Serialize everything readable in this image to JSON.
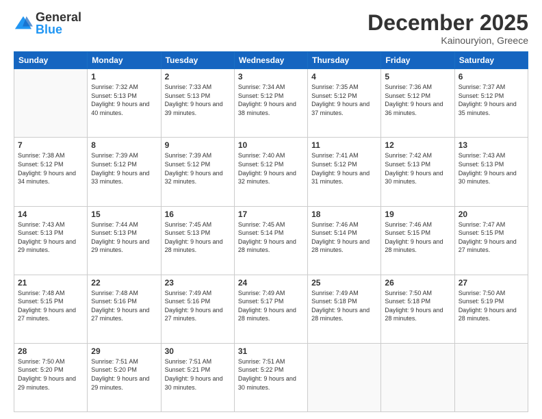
{
  "logo": {
    "general": "General",
    "blue": "Blue"
  },
  "header": {
    "month": "December 2025",
    "location": "Kainouryion, Greece"
  },
  "weekdays": [
    "Sunday",
    "Monday",
    "Tuesday",
    "Wednesday",
    "Thursday",
    "Friday",
    "Saturday"
  ],
  "weeks": [
    [
      {
        "day": "",
        "sunrise": "",
        "sunset": "",
        "daylight": ""
      },
      {
        "day": "1",
        "sunrise": "Sunrise: 7:32 AM",
        "sunset": "Sunset: 5:13 PM",
        "daylight": "Daylight: 9 hours and 40 minutes."
      },
      {
        "day": "2",
        "sunrise": "Sunrise: 7:33 AM",
        "sunset": "Sunset: 5:13 PM",
        "daylight": "Daylight: 9 hours and 39 minutes."
      },
      {
        "day": "3",
        "sunrise": "Sunrise: 7:34 AM",
        "sunset": "Sunset: 5:12 PM",
        "daylight": "Daylight: 9 hours and 38 minutes."
      },
      {
        "day": "4",
        "sunrise": "Sunrise: 7:35 AM",
        "sunset": "Sunset: 5:12 PM",
        "daylight": "Daylight: 9 hours and 37 minutes."
      },
      {
        "day": "5",
        "sunrise": "Sunrise: 7:36 AM",
        "sunset": "Sunset: 5:12 PM",
        "daylight": "Daylight: 9 hours and 36 minutes."
      },
      {
        "day": "6",
        "sunrise": "Sunrise: 7:37 AM",
        "sunset": "Sunset: 5:12 PM",
        "daylight": "Daylight: 9 hours and 35 minutes."
      }
    ],
    [
      {
        "day": "7",
        "sunrise": "Sunrise: 7:38 AM",
        "sunset": "Sunset: 5:12 PM",
        "daylight": "Daylight: 9 hours and 34 minutes."
      },
      {
        "day": "8",
        "sunrise": "Sunrise: 7:39 AM",
        "sunset": "Sunset: 5:12 PM",
        "daylight": "Daylight: 9 hours and 33 minutes."
      },
      {
        "day": "9",
        "sunrise": "Sunrise: 7:39 AM",
        "sunset": "Sunset: 5:12 PM",
        "daylight": "Daylight: 9 hours and 32 minutes."
      },
      {
        "day": "10",
        "sunrise": "Sunrise: 7:40 AM",
        "sunset": "Sunset: 5:12 PM",
        "daylight": "Daylight: 9 hours and 32 minutes."
      },
      {
        "day": "11",
        "sunrise": "Sunrise: 7:41 AM",
        "sunset": "Sunset: 5:12 PM",
        "daylight": "Daylight: 9 hours and 31 minutes."
      },
      {
        "day": "12",
        "sunrise": "Sunrise: 7:42 AM",
        "sunset": "Sunset: 5:13 PM",
        "daylight": "Daylight: 9 hours and 30 minutes."
      },
      {
        "day": "13",
        "sunrise": "Sunrise: 7:43 AM",
        "sunset": "Sunset: 5:13 PM",
        "daylight": "Daylight: 9 hours and 30 minutes."
      }
    ],
    [
      {
        "day": "14",
        "sunrise": "Sunrise: 7:43 AM",
        "sunset": "Sunset: 5:13 PM",
        "daylight": "Daylight: 9 hours and 29 minutes."
      },
      {
        "day": "15",
        "sunrise": "Sunrise: 7:44 AM",
        "sunset": "Sunset: 5:13 PM",
        "daylight": "Daylight: 9 hours and 29 minutes."
      },
      {
        "day": "16",
        "sunrise": "Sunrise: 7:45 AM",
        "sunset": "Sunset: 5:13 PM",
        "daylight": "Daylight: 9 hours and 28 minutes."
      },
      {
        "day": "17",
        "sunrise": "Sunrise: 7:45 AM",
        "sunset": "Sunset: 5:14 PM",
        "daylight": "Daylight: 9 hours and 28 minutes."
      },
      {
        "day": "18",
        "sunrise": "Sunrise: 7:46 AM",
        "sunset": "Sunset: 5:14 PM",
        "daylight": "Daylight: 9 hours and 28 minutes."
      },
      {
        "day": "19",
        "sunrise": "Sunrise: 7:46 AM",
        "sunset": "Sunset: 5:15 PM",
        "daylight": "Daylight: 9 hours and 28 minutes."
      },
      {
        "day": "20",
        "sunrise": "Sunrise: 7:47 AM",
        "sunset": "Sunset: 5:15 PM",
        "daylight": "Daylight: 9 hours and 27 minutes."
      }
    ],
    [
      {
        "day": "21",
        "sunrise": "Sunrise: 7:48 AM",
        "sunset": "Sunset: 5:15 PM",
        "daylight": "Daylight: 9 hours and 27 minutes."
      },
      {
        "day": "22",
        "sunrise": "Sunrise: 7:48 AM",
        "sunset": "Sunset: 5:16 PM",
        "daylight": "Daylight: 9 hours and 27 minutes."
      },
      {
        "day": "23",
        "sunrise": "Sunrise: 7:49 AM",
        "sunset": "Sunset: 5:16 PM",
        "daylight": "Daylight: 9 hours and 27 minutes."
      },
      {
        "day": "24",
        "sunrise": "Sunrise: 7:49 AM",
        "sunset": "Sunset: 5:17 PM",
        "daylight": "Daylight: 9 hours and 28 minutes."
      },
      {
        "day": "25",
        "sunrise": "Sunrise: 7:49 AM",
        "sunset": "Sunset: 5:18 PM",
        "daylight": "Daylight: 9 hours and 28 minutes."
      },
      {
        "day": "26",
        "sunrise": "Sunrise: 7:50 AM",
        "sunset": "Sunset: 5:18 PM",
        "daylight": "Daylight: 9 hours and 28 minutes."
      },
      {
        "day": "27",
        "sunrise": "Sunrise: 7:50 AM",
        "sunset": "Sunset: 5:19 PM",
        "daylight": "Daylight: 9 hours and 28 minutes."
      }
    ],
    [
      {
        "day": "28",
        "sunrise": "Sunrise: 7:50 AM",
        "sunset": "Sunset: 5:20 PM",
        "daylight": "Daylight: 9 hours and 29 minutes."
      },
      {
        "day": "29",
        "sunrise": "Sunrise: 7:51 AM",
        "sunset": "Sunset: 5:20 PM",
        "daylight": "Daylight: 9 hours and 29 minutes."
      },
      {
        "day": "30",
        "sunrise": "Sunrise: 7:51 AM",
        "sunset": "Sunset: 5:21 PM",
        "daylight": "Daylight: 9 hours and 30 minutes."
      },
      {
        "day": "31",
        "sunrise": "Sunrise: 7:51 AM",
        "sunset": "Sunset: 5:22 PM",
        "daylight": "Daylight: 9 hours and 30 minutes."
      },
      {
        "day": "",
        "sunrise": "",
        "sunset": "",
        "daylight": ""
      },
      {
        "day": "",
        "sunrise": "",
        "sunset": "",
        "daylight": ""
      },
      {
        "day": "",
        "sunrise": "",
        "sunset": "",
        "daylight": ""
      }
    ]
  ]
}
